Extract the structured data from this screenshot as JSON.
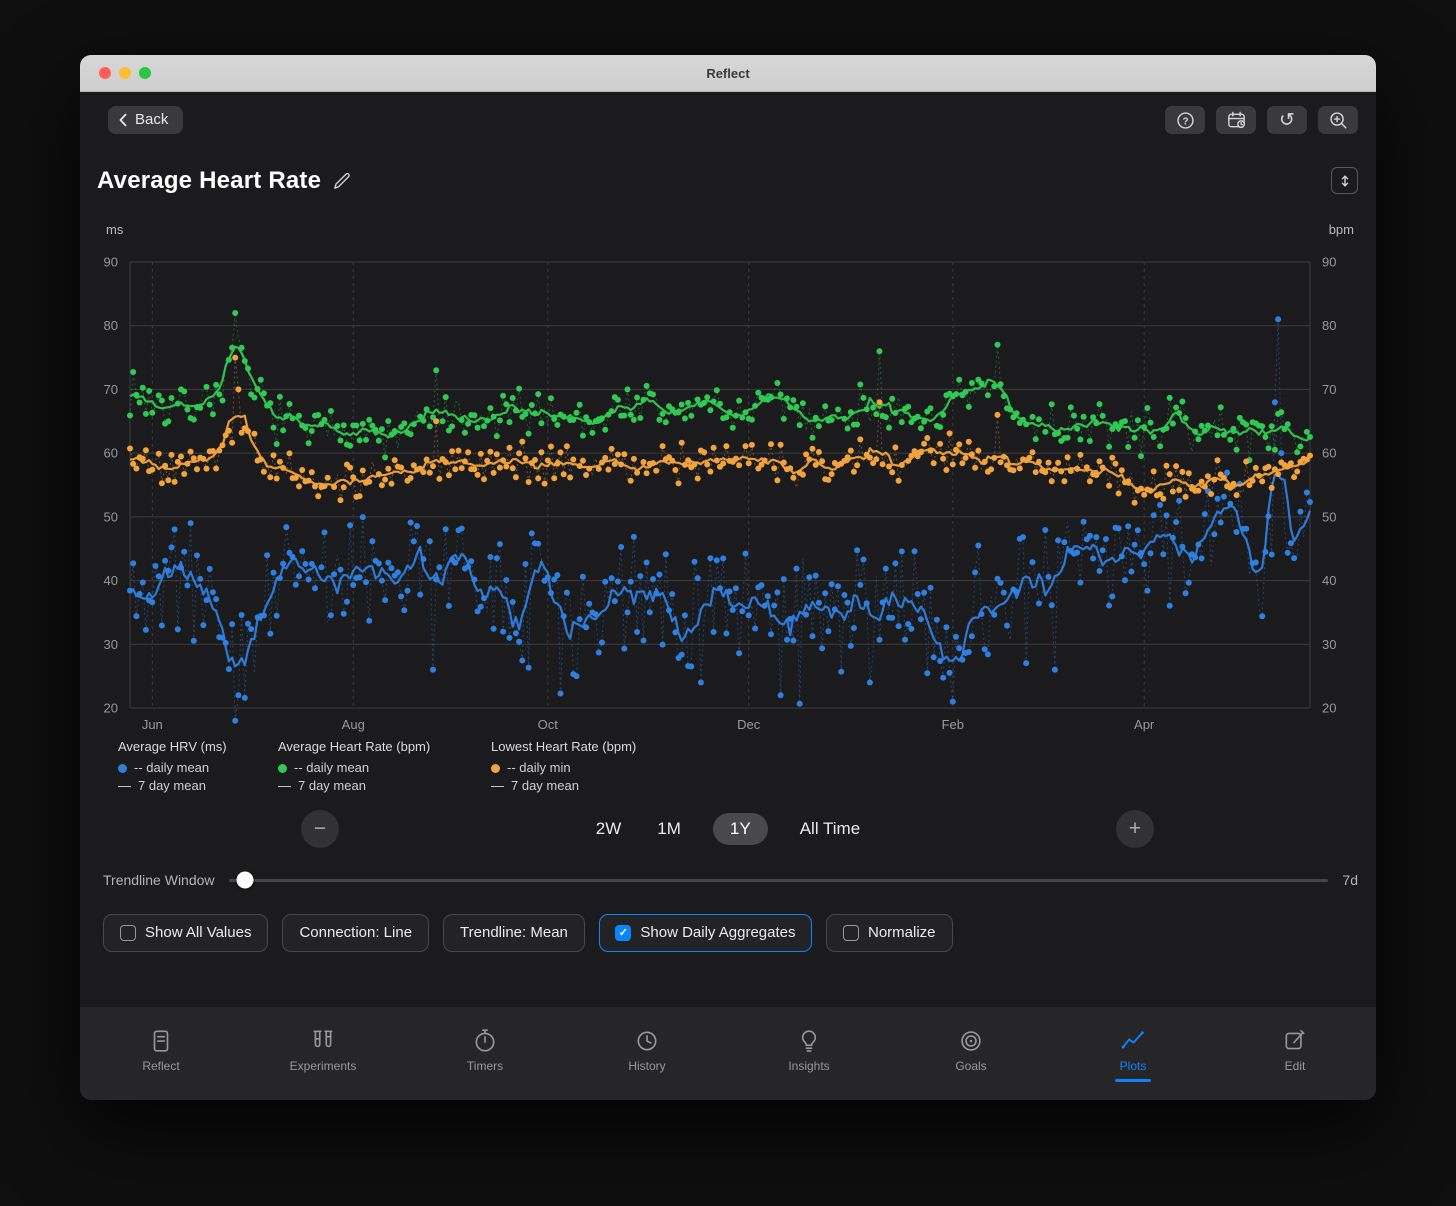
{
  "window": {
    "title": "Reflect"
  },
  "toolbar": {
    "back_label": "Back"
  },
  "header": {
    "title": "Average Heart Rate"
  },
  "chart_data": {
    "type": "scatter",
    "ylabel_left": "ms",
    "ylabel_right": "bpm",
    "ylim": [
      20,
      90
    ],
    "yticks": [
      20,
      30,
      40,
      50,
      60,
      70,
      80,
      90
    ],
    "x_days": 370,
    "grid": true,
    "months": [
      {
        "label": "Jun",
        "day": 7
      },
      {
        "label": "Aug",
        "day": 70
      },
      {
        "label": "Oct",
        "day": 131
      },
      {
        "label": "Dec",
        "day": 194
      },
      {
        "label": "Feb",
        "day": 258
      },
      {
        "label": "Apr",
        "day": 318
      }
    ],
    "series": [
      {
        "name": "Average HRV (ms)",
        "unit": "ms",
        "style": "daily mean dots + 7 day mean line",
        "color": "#2e80e0",
        "seed": 11,
        "noise": 6.0,
        "dip_prob": 0.05,
        "trend": [
          [
            0,
            38
          ],
          [
            10,
            40
          ],
          [
            20,
            43
          ],
          [
            28,
            36
          ],
          [
            33,
            26
          ],
          [
            40,
            33
          ],
          [
            50,
            44
          ],
          [
            60,
            42
          ],
          [
            70,
            40
          ],
          [
            80,
            42
          ],
          [
            90,
            46
          ],
          [
            100,
            44
          ],
          [
            110,
            41
          ],
          [
            120,
            39
          ],
          [
            128,
            43
          ],
          [
            136,
            38
          ],
          [
            145,
            36
          ],
          [
            155,
            38
          ],
          [
            165,
            37
          ],
          [
            175,
            36
          ],
          [
            185,
            38
          ],
          [
            194,
            37
          ],
          [
            200,
            34
          ],
          [
            207,
            38
          ],
          [
            215,
            36
          ],
          [
            222,
            33
          ],
          [
            230,
            37
          ],
          [
            240,
            38
          ],
          [
            248,
            34
          ],
          [
            255,
            31
          ],
          [
            262,
            36
          ],
          [
            270,
            40
          ],
          [
            278,
            38
          ],
          [
            285,
            41
          ],
          [
            295,
            44
          ],
          [
            305,
            42
          ],
          [
            315,
            46
          ],
          [
            325,
            48
          ],
          [
            335,
            44
          ],
          [
            345,
            49
          ],
          [
            352,
            45
          ],
          [
            358,
            47
          ],
          [
            364,
            46
          ],
          [
            370,
            52
          ]
        ],
        "outliers": [
          [
            33,
            18
          ],
          [
            34,
            22
          ],
          [
            95,
            26
          ],
          [
            140,
            25
          ],
          [
            179,
            24
          ],
          [
            204,
            22
          ],
          [
            232,
            24
          ],
          [
            258,
            21
          ],
          [
            290,
            26
          ],
          [
            359,
            68
          ],
          [
            360,
            81
          ],
          [
            361,
            60
          ]
        ]
      },
      {
        "name": "Average Heart Rate (bpm)",
        "unit": "bpm",
        "style": "daily mean dots + 7 day mean line",
        "color": "#30c952",
        "seed": 7,
        "noise": 2.6,
        "dip_prob": 0,
        "trend": [
          [
            0,
            70
          ],
          [
            8,
            68
          ],
          [
            15,
            67
          ],
          [
            22,
            68
          ],
          [
            28,
            70
          ],
          [
            33,
            75
          ],
          [
            38,
            70
          ],
          [
            45,
            66
          ],
          [
            52,
            64
          ],
          [
            60,
            63
          ],
          [
            68,
            65
          ],
          [
            75,
            63
          ],
          [
            82,
            62
          ],
          [
            90,
            64
          ],
          [
            98,
            66
          ],
          [
            105,
            64
          ],
          [
            112,
            65
          ],
          [
            120,
            66
          ],
          [
            128,
            67
          ],
          [
            136,
            66
          ],
          [
            145,
            65
          ],
          [
            152,
            67
          ],
          [
            160,
            68
          ],
          [
            168,
            66
          ],
          [
            175,
            67
          ],
          [
            182,
            68
          ],
          [
            190,
            66
          ],
          [
            197,
            67
          ],
          [
            205,
            68
          ],
          [
            212,
            66
          ],
          [
            220,
            65
          ],
          [
            228,
            67
          ],
          [
            235,
            68
          ],
          [
            242,
            64
          ],
          [
            250,
            66
          ],
          [
            258,
            67
          ],
          [
            264,
            69
          ],
          [
            272,
            70
          ],
          [
            278,
            65
          ],
          [
            285,
            65
          ],
          [
            292,
            64
          ],
          [
            300,
            65
          ],
          [
            308,
            64
          ],
          [
            315,
            63
          ],
          [
            322,
            64
          ],
          [
            330,
            65
          ],
          [
            338,
            63
          ],
          [
            345,
            64
          ],
          [
            352,
            63
          ],
          [
            358,
            64
          ],
          [
            364,
            63
          ],
          [
            370,
            64
          ]
        ],
        "outliers": [
          [
            33,
            82
          ],
          [
            34,
            78
          ],
          [
            96,
            73
          ],
          [
            235,
            76
          ],
          [
            272,
            77
          ]
        ]
      },
      {
        "name": "Lowest Heart Rate (bpm)",
        "unit": "bpm",
        "style": "daily min dots + 7 day mean line",
        "color": "#f2a33c",
        "seed": 5,
        "noise": 2.2,
        "dip_prob": 0,
        "trend": [
          [
            0,
            59
          ],
          [
            10,
            58
          ],
          [
            20,
            58
          ],
          [
            28,
            60
          ],
          [
            33,
            66
          ],
          [
            38,
            61
          ],
          [
            45,
            58
          ],
          [
            52,
            57
          ],
          [
            60,
            55
          ],
          [
            68,
            56
          ],
          [
            75,
            56
          ],
          [
            82,
            57
          ],
          [
            90,
            58
          ],
          [
            100,
            59
          ],
          [
            110,
            58
          ],
          [
            120,
            59
          ],
          [
            130,
            58
          ],
          [
            140,
            58
          ],
          [
            150,
            59
          ],
          [
            160,
            58
          ],
          [
            170,
            59
          ],
          [
            180,
            58
          ],
          [
            190,
            59
          ],
          [
            200,
            59
          ],
          [
            210,
            58
          ],
          [
            220,
            58
          ],
          [
            230,
            59
          ],
          [
            240,
            58
          ],
          [
            250,
            59
          ],
          [
            258,
            61
          ],
          [
            265,
            60
          ],
          [
            272,
            58
          ],
          [
            280,
            59
          ],
          [
            288,
            58
          ],
          [
            295,
            57
          ],
          [
            302,
            58
          ],
          [
            310,
            56
          ],
          [
            318,
            55
          ],
          [
            325,
            56
          ],
          [
            332,
            55
          ],
          [
            340,
            56
          ],
          [
            348,
            55
          ],
          [
            355,
            56
          ],
          [
            362,
            57
          ],
          [
            370,
            59
          ]
        ],
        "outliers": [
          [
            33,
            75
          ],
          [
            34,
            70
          ],
          [
            96,
            65
          ],
          [
            235,
            68
          ],
          [
            272,
            66
          ]
        ]
      }
    ]
  },
  "legend": {
    "groups": [
      {
        "title": "Average HRV (ms)",
        "color": "#2e80e0",
        "daily": "-- daily mean",
        "weekly": "7 day mean",
        "weekly_dash": "—"
      },
      {
        "title": "Average Heart Rate (bpm)",
        "color": "#30c952",
        "daily": "-- daily mean",
        "weekly": "7 day mean",
        "weekly_dash": "—"
      },
      {
        "title": "Lowest Heart Rate (bpm)",
        "color": "#f2a33c",
        "daily": "-- daily min",
        "weekly": "7 day mean",
        "weekly_dash": "—"
      }
    ]
  },
  "zoom": {
    "minus": "−",
    "plus": "+",
    "options": [
      {
        "label": "2W",
        "selected": false
      },
      {
        "label": "1M",
        "selected": false
      },
      {
        "label": "1Y",
        "selected": true
      },
      {
        "label": "All Time",
        "selected": false
      }
    ]
  },
  "trendline": {
    "label": "Trendline Window",
    "value": "7d",
    "position_pct": 1.5
  },
  "toggles": [
    {
      "label": "Show All Values",
      "has_checkbox": true,
      "checked": false,
      "accent": false
    },
    {
      "label": "Connection: Line",
      "has_checkbox": false,
      "checked": false,
      "accent": false
    },
    {
      "label": "Trendline: Mean",
      "has_checkbox": false,
      "checked": false,
      "accent": false
    },
    {
      "label": "Show Daily Aggregates",
      "has_checkbox": true,
      "checked": true,
      "accent": true
    },
    {
      "label": "Normalize",
      "has_checkbox": true,
      "checked": false,
      "accent": false
    }
  ],
  "tabbar": {
    "items": [
      {
        "label": "Reflect",
        "active": false
      },
      {
        "label": "Experiments",
        "active": false
      },
      {
        "label": "Timers",
        "active": false
      },
      {
        "label": "History",
        "active": false
      },
      {
        "label": "Insights",
        "active": false
      },
      {
        "label": "Goals",
        "active": false
      },
      {
        "label": "Plots",
        "active": true
      },
      {
        "label": "Edit",
        "active": false
      }
    ]
  },
  "colors": {
    "accent": "#0a84ff",
    "hrv": "#2e80e0",
    "avg_hr": "#30c952",
    "lowest_hr": "#f2a33c"
  }
}
